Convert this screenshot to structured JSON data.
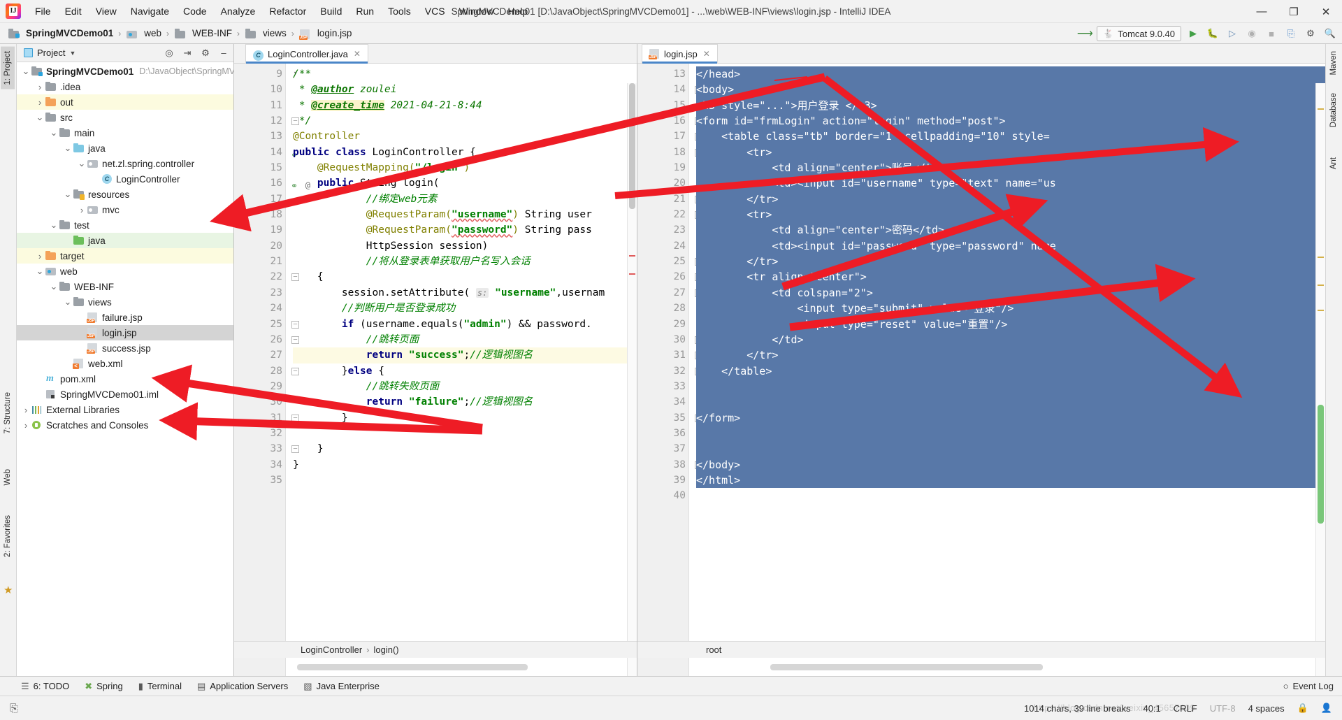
{
  "window": {
    "title": "SpringMVCDemo01 [D:\\JavaObject\\SpringMVCDemo01] - ...\\web\\WEB-INF\\views\\login.jsp - IntelliJ IDEA",
    "minimize": "—",
    "maximize": "❐",
    "close": "✕"
  },
  "menu": [
    "File",
    "Edit",
    "View",
    "Navigate",
    "Code",
    "Analyze",
    "Refactor",
    "Build",
    "Run",
    "Tools",
    "VCS",
    "Window",
    "Help"
  ],
  "breadcrumb": {
    "items": [
      "SpringMVCDemo01",
      "web",
      "WEB-INF",
      "views",
      "login.jsp"
    ],
    "separator": "›"
  },
  "toolbar": {
    "run_config": "Tomcat 9.0.40",
    "run_icon": "run-icon",
    "debug_icon": "debug-icon",
    "search_icon": "search-icon"
  },
  "left_strip": {
    "tabs": [
      "1: Project",
      "7: Structure",
      "Web",
      "2: Favorites"
    ]
  },
  "right_strip": {
    "tabs": [
      "Maven",
      "Database",
      "Ant"
    ]
  },
  "project_panel": {
    "title": "Project",
    "tree": [
      {
        "depth": 0,
        "arrow": "v",
        "icon": "folder-module",
        "label": "SpringMVCDemo01",
        "sub": "D:\\JavaObject\\SpringMV",
        "bold": true,
        "row": "normal"
      },
      {
        "depth": 1,
        "arrow": ">",
        "icon": "folder-gray",
        "label": ".idea",
        "sub": "",
        "bold": false,
        "row": "normal"
      },
      {
        "depth": 1,
        "arrow": ">",
        "icon": "folder-orange",
        "label": "out",
        "sub": "",
        "bold": false,
        "row": "yellow"
      },
      {
        "depth": 1,
        "arrow": "v",
        "icon": "folder-gray",
        "label": "src",
        "sub": "",
        "bold": false,
        "row": "normal"
      },
      {
        "depth": 2,
        "arrow": "v",
        "icon": "folder-gray",
        "label": "main",
        "sub": "",
        "bold": false,
        "row": "normal"
      },
      {
        "depth": 3,
        "arrow": "v",
        "icon": "folder-blue",
        "label": "java",
        "sub": "",
        "bold": false,
        "row": "normal"
      },
      {
        "depth": 4,
        "arrow": "v",
        "icon": "package",
        "label": "net.zl.spring.controller",
        "sub": "",
        "bold": false,
        "row": "normal"
      },
      {
        "depth": 5,
        "arrow": "",
        "icon": "class",
        "label": "LoginController",
        "sub": "",
        "bold": false,
        "row": "normal"
      },
      {
        "depth": 3,
        "arrow": "v",
        "icon": "folder-resources",
        "label": "resources",
        "sub": "",
        "bold": false,
        "row": "normal"
      },
      {
        "depth": 4,
        "arrow": ">",
        "icon": "package",
        "label": "mvc",
        "sub": "",
        "bold": false,
        "row": "normal"
      },
      {
        "depth": 2,
        "arrow": "v",
        "icon": "folder-gray",
        "label": "test",
        "sub": "",
        "bold": false,
        "row": "normal"
      },
      {
        "depth": 3,
        "arrow": "",
        "icon": "folder-green",
        "label": "java",
        "sub": "",
        "bold": false,
        "row": "green"
      },
      {
        "depth": 1,
        "arrow": ">",
        "icon": "folder-orange",
        "label": "target",
        "sub": "",
        "bold": false,
        "row": "yellow"
      },
      {
        "depth": 1,
        "arrow": "v",
        "icon": "web",
        "label": "web",
        "sub": "",
        "bold": false,
        "row": "normal"
      },
      {
        "depth": 2,
        "arrow": "v",
        "icon": "folder-gray",
        "label": "WEB-INF",
        "sub": "",
        "bold": false,
        "row": "normal"
      },
      {
        "depth": 3,
        "arrow": "v",
        "icon": "folder-gray",
        "label": "views",
        "sub": "",
        "bold": false,
        "row": "normal"
      },
      {
        "depth": 4,
        "arrow": "",
        "icon": "jsp",
        "label": "failure.jsp",
        "sub": "",
        "bold": false,
        "row": "normal"
      },
      {
        "depth": 4,
        "arrow": "",
        "icon": "jsp",
        "label": "login.jsp",
        "sub": "",
        "bold": false,
        "row": "selected"
      },
      {
        "depth": 4,
        "arrow": "",
        "icon": "jsp",
        "label": "success.jsp",
        "sub": "",
        "bold": false,
        "row": "normal"
      },
      {
        "depth": 3,
        "arrow": "",
        "icon": "xml",
        "label": "web.xml",
        "sub": "",
        "bold": false,
        "row": "normal"
      },
      {
        "depth": 1,
        "arrow": "",
        "icon": "maven",
        "label": "pom.xml",
        "sub": "",
        "bold": false,
        "row": "normal"
      },
      {
        "depth": 1,
        "arrow": "",
        "icon": "iml",
        "label": "SpringMVCDemo01.iml",
        "sub": "",
        "bold": false,
        "row": "normal"
      },
      {
        "depth": 0,
        "arrow": ">",
        "icon": "library",
        "label": "External Libraries",
        "sub": "",
        "bold": false,
        "row": "normal"
      },
      {
        "depth": 0,
        "arrow": ">",
        "icon": "scratch",
        "label": "Scratches and Consoles",
        "sub": "",
        "bold": false,
        "row": "normal"
      }
    ]
  },
  "editor_java": {
    "tab": {
      "label": "LoginController.java",
      "icon": "class-icon",
      "close": "✕"
    },
    "first_line": 9,
    "lines": [
      {
        "n": 9,
        "text": "/**"
      },
      {
        "n": 10,
        "text": " * @author zoulei"
      },
      {
        "n": 11,
        "text": " * @create_time 2021-04-21-8:44"
      },
      {
        "n": 12,
        "text": " */"
      },
      {
        "n": 13,
        "text": "@Controller"
      },
      {
        "n": 14,
        "text": "public class LoginController {"
      },
      {
        "n": 15,
        "text": "    @RequestMapping(\"/login\")"
      },
      {
        "n": 16,
        "text": "    public String login("
      },
      {
        "n": 17,
        "text": "            //绑定web元素"
      },
      {
        "n": 18,
        "text": "            @RequestParam(\"username\") String user"
      },
      {
        "n": 19,
        "text": "            @RequestParam(\"password\") String pass"
      },
      {
        "n": 20,
        "text": "            HttpSession session)"
      },
      {
        "n": 21,
        "text": "            //将从登录表单获取用户名写入会话"
      },
      {
        "n": 22,
        "text": "    {"
      },
      {
        "n": 23,
        "text": "        session.setAttribute( s: \"username\",usernam"
      },
      {
        "n": 24,
        "text": "        //判断用户是否登录成功"
      },
      {
        "n": 25,
        "text": "        if (username.equals(\"admin\") && password."
      },
      {
        "n": 26,
        "text": "            //跳转页面"
      },
      {
        "n": 27,
        "text": "            return \"success\";//逻辑视图名"
      },
      {
        "n": 28,
        "text": "        }else {"
      },
      {
        "n": 29,
        "text": "            //跳转失败页面"
      },
      {
        "n": 30,
        "text": "            return \"failure\";//逻辑视图名"
      },
      {
        "n": 31,
        "text": "        }"
      },
      {
        "n": 32,
        "text": ""
      },
      {
        "n": 33,
        "text": "    }"
      },
      {
        "n": 34,
        "text": "}"
      },
      {
        "n": 35,
        "text": ""
      }
    ],
    "breadcrumb": [
      "LoginController",
      "login()"
    ],
    "breadcrumb_sep": "›"
  },
  "editor_jsp": {
    "tab": {
      "label": "login.jsp",
      "icon": "jsp-icon",
      "close": "✕"
    },
    "lines": [
      {
        "n": 13,
        "text": "</head>"
      },
      {
        "n": 14,
        "text": "<body>"
      },
      {
        "n": 15,
        "text": "<h3 style=\"...\">用户登录 </h3>"
      },
      {
        "n": 16,
        "text": "<form id=\"frmLogin\" action=\"login\" method=\"post\">"
      },
      {
        "n": 17,
        "text": "    <table class=\"tb\" border=\"1\" cellpadding=\"10\" style="
      },
      {
        "n": 18,
        "text": "        <tr>"
      },
      {
        "n": 19,
        "text": "            <td align=\"center\">账号</td>"
      },
      {
        "n": 20,
        "text": "            <td><input id=\"username\" type=\"text\" name=\"us"
      },
      {
        "n": 21,
        "text": "        </tr>"
      },
      {
        "n": 22,
        "text": "        <tr>"
      },
      {
        "n": 23,
        "text": "            <td align=\"center\">密码</td>"
      },
      {
        "n": 24,
        "text": "            <td><input id=\"password\" type=\"password\" name"
      },
      {
        "n": 25,
        "text": "        </tr>"
      },
      {
        "n": 26,
        "text": "        <tr align=\"center\">"
      },
      {
        "n": 27,
        "text": "            <td colspan=\"2\">"
      },
      {
        "n": 28,
        "text": "                <input type=\"submit\" value=\"登录\"/>"
      },
      {
        "n": 29,
        "text": "                <input type=\"reset\" value=\"重置\"/>"
      },
      {
        "n": 30,
        "text": "            </td>"
      },
      {
        "n": 31,
        "text": "        </tr>"
      },
      {
        "n": 32,
        "text": "    </table>"
      },
      {
        "n": 33,
        "text": ""
      },
      {
        "n": 34,
        "text": ""
      },
      {
        "n": 35,
        "text": "</form>"
      },
      {
        "n": 36,
        "text": ""
      },
      {
        "n": 37,
        "text": ""
      },
      {
        "n": 38,
        "text": "</body>"
      },
      {
        "n": 39,
        "text": "</html>"
      },
      {
        "n": 40,
        "text": ""
      }
    ],
    "breadcrumb": [
      "root"
    ]
  },
  "bottom_tools": [
    {
      "label": "6: TODO",
      "icon": "todo-icon"
    },
    {
      "label": "Spring",
      "icon": "spring-icon"
    },
    {
      "label": "Terminal",
      "icon": "terminal-icon"
    },
    {
      "label": "Application Servers",
      "icon": "server-icon"
    },
    {
      "label": "Java Enterprise",
      "icon": "jee-icon"
    }
  ],
  "bottom_right": {
    "label": "Event Log",
    "icon": "event-log-icon"
  },
  "status": {
    "chars": "1014 chars, 39 line breaks",
    "caret": "40:1",
    "line_sep": "CRLF",
    "encoding": "UTF-8",
    "indent": "4 spaces",
    "lock_icon": "lock-icon",
    "inspection_icon": "inspector-icon",
    "watermark": "https://blog.csdn.net/weixin_45657409"
  },
  "colors": {
    "accent_blue": "#4a86c8",
    "selection_blue": "#5878a8",
    "arrow_red": "#ee1c25",
    "keyword": "#000080",
    "string": "#008000",
    "annotation": "#808000",
    "comment": "#008000"
  }
}
